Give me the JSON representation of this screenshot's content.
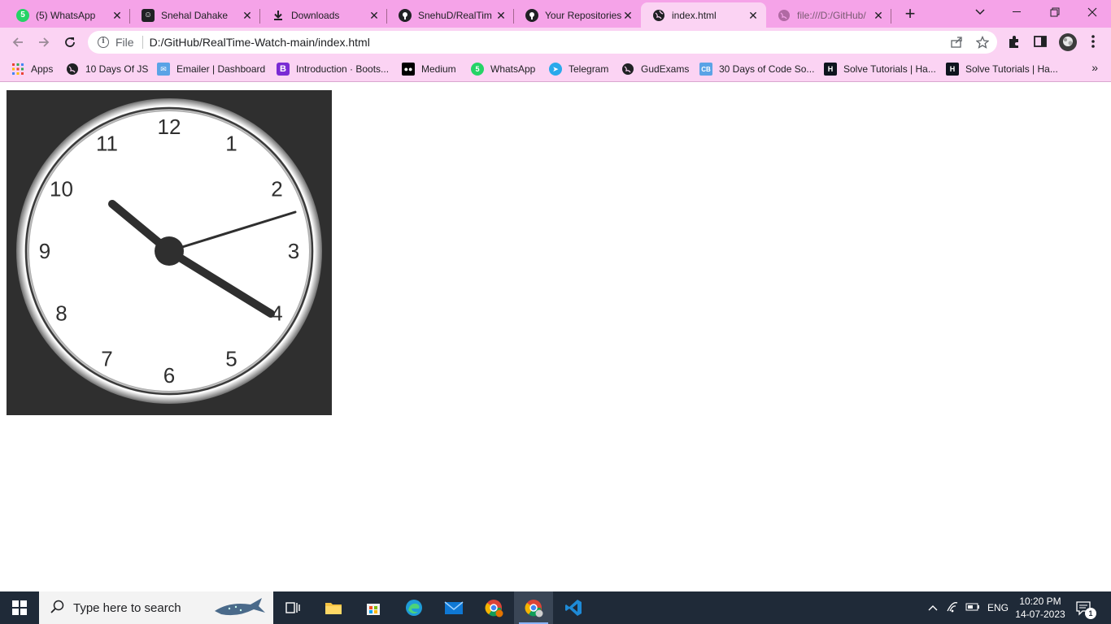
{
  "browser": {
    "tabs": [
      {
        "title": "(5) WhatsApp",
        "icon": "whatsapp-icon",
        "icon_color": "#25d366",
        "badge": "5"
      },
      {
        "title": "Snehal Dahake",
        "icon": "profile-icon",
        "icon_color": "#202124",
        "badge": ""
      },
      {
        "title": "Downloads",
        "icon": "download-icon",
        "icon_color": "#202124",
        "badge": ""
      },
      {
        "title": "SnehuD/RealTim",
        "icon": "github-icon",
        "icon_color": "#202124",
        "badge": ""
      },
      {
        "title": "Your Repositories",
        "icon": "github-icon",
        "icon_color": "#202124",
        "badge": ""
      },
      {
        "title": "index.html",
        "icon": "globe-icon",
        "icon_color": "#202124",
        "badge": ""
      },
      {
        "title": "file:///D:/GitHub/",
        "icon": "globe-icon",
        "icon_color": "#8a8a8a",
        "badge": ""
      }
    ],
    "active_tab_index": 5,
    "address_bar": {
      "scheme_label": "File",
      "url": "D:/GitHub/RealTime-Watch-main/index.html"
    },
    "bookmarks": [
      {
        "label": "Apps",
        "icon": "apps-grid-icon"
      },
      {
        "label": "10 Days Of JS",
        "icon": "globe-icon"
      },
      {
        "label": "Emailer | Dashboard",
        "icon": "emailer-icon"
      },
      {
        "label": "Introduction · Boots...",
        "icon": "bootstrap-icon"
      },
      {
        "label": "Medium",
        "icon": "medium-icon"
      },
      {
        "label": "WhatsApp",
        "icon": "whatsapp-icon"
      },
      {
        "label": "Telegram",
        "icon": "telegram-icon"
      },
      {
        "label": "GudExams",
        "icon": "globe-icon"
      },
      {
        "label": "30 Days of Code So...",
        "icon": "codingblocks-icon"
      },
      {
        "label": "Solve Tutorials | Ha...",
        "icon": "hackerrank-icon"
      },
      {
        "label": "Solve Tutorials | Ha...",
        "icon": "hackerrank-icon"
      }
    ],
    "colors": {
      "frame": "#f5a3e8",
      "toolbar": "#fbd3f3"
    }
  },
  "clock": {
    "numerals": [
      "12",
      "1",
      "2",
      "3",
      "4",
      "5",
      "6",
      "7",
      "8",
      "9",
      "10",
      "11"
    ],
    "face_color": "#ffffff",
    "background_color": "#2f2f2f",
    "hand_color": "#2f2f2f"
  },
  "taskbar": {
    "search_placeholder": "Type here to search",
    "apps": [
      "task-view-icon",
      "file-explorer-icon",
      "store-icon",
      "edge-icon",
      "mail-icon",
      "chrome-profile-icon",
      "chrome-icon",
      "vscode-icon"
    ],
    "active_app": "chrome-icon",
    "tray": {
      "language": "ENG",
      "time": "10:20 PM",
      "date": "14-07-2023",
      "notification_count": "1"
    }
  }
}
